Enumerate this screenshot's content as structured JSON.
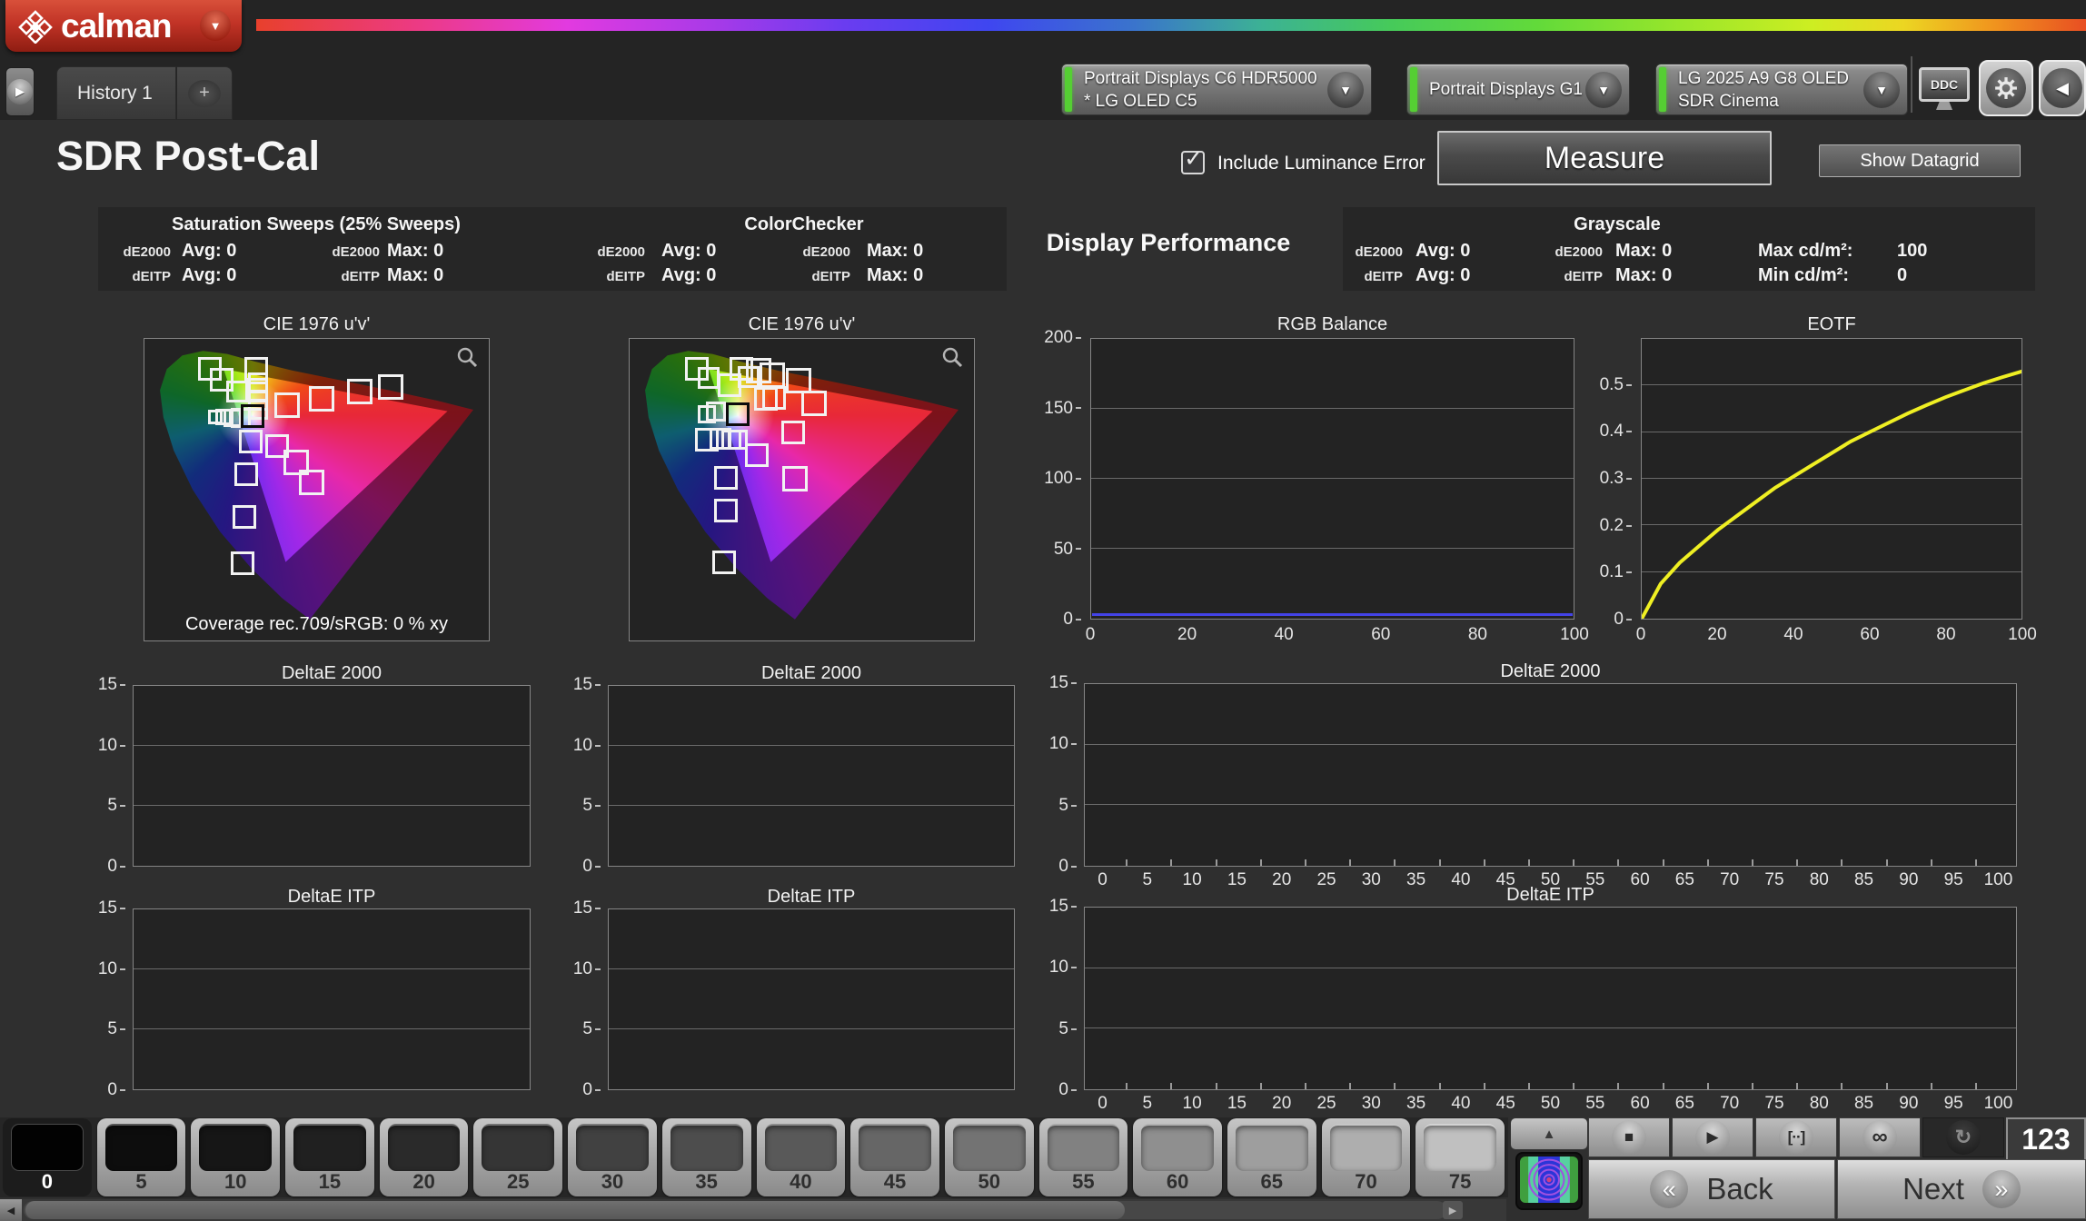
{
  "header": {
    "logo": {
      "text": "calman",
      "dropdown_icon": "▼"
    },
    "tab_strip": {
      "expand_icon": "▶",
      "history_tab": "History 1",
      "add_tab": "+"
    },
    "meters": [
      {
        "line1": "Portrait Displays C6 HDR5000",
        "line2": "* LG OLED C5"
      },
      {
        "line1": "Portrait Displays G1",
        "line2": ""
      },
      {
        "line1": "LG 2025 A9 G8 OLED",
        "line2": "SDR Cinema"
      }
    ],
    "ddc_label": "DDC",
    "collapse_icon": "◀",
    "accent_green": "#55cf33",
    "brand_red": "#c13326"
  },
  "toolbar": {
    "page_title": "SDR Post-Cal",
    "include_luminance_error": "Include Luminance Error",
    "checkbox_checked": true,
    "checkbox_mark": "✓",
    "measure_label": "Measure",
    "show_datagrid_label": "Show Datagrid"
  },
  "stats": {
    "saturation": {
      "title": "Saturation Sweeps (25% Sweeps)",
      "rows": [
        {
          "m1": "dE2000",
          "v1": "Avg: 0",
          "m2": "dE2000",
          "v2": "Max: 0"
        },
        {
          "m1": "dEITP",
          "v1": "Avg: 0",
          "m2": "dEITP",
          "v2": "Max: 0"
        }
      ]
    },
    "colorchecker": {
      "title": "ColorChecker",
      "rows": [
        {
          "m1": "dE2000",
          "v1": "Avg: 0",
          "m2": "dE2000",
          "v2": "Max: 0"
        },
        {
          "m1": "dEITP",
          "v1": "Avg: 0",
          "m2": "dEITP",
          "v2": "Max: 0"
        }
      ]
    },
    "display_performance": "Display Performance",
    "grayscale": {
      "title": "Grayscale",
      "rows": [
        {
          "m1": "dE2000",
          "v1": "Avg: 0",
          "m2": "dE2000",
          "v2": "Max: 0",
          "l3": "Max cd/m²:",
          "v3": "100"
        },
        {
          "m1": "dEITP",
          "v1": "Avg: 0",
          "m2": "dEITP",
          "v2": "Max: 0",
          "l3": "Min cd/m²:",
          "v3": "0"
        }
      ]
    }
  },
  "chart_data": [
    {
      "id": "cie1",
      "type": "scatter",
      "title": "CIE 1976 u'v'",
      "coverage_label": "Coverage rec.709/sRGB:  0 % xy",
      "markers": [
        [
          19,
          10,
          26,
          "w"
        ],
        [
          22.5,
          13.5,
          26,
          "w"
        ],
        [
          27,
          17.5,
          24,
          "w"
        ],
        [
          32.5,
          10,
          26,
          "w"
        ],
        [
          33,
          14.5,
          22,
          "w"
        ],
        [
          33,
          17.5,
          22,
          "w"
        ],
        [
          33,
          20.5,
          22,
          "w"
        ],
        [
          33,
          23.5,
          22,
          "w"
        ],
        [
          41.5,
          22,
          28,
          "w"
        ],
        [
          51.5,
          20,
          28,
          "w"
        ],
        [
          62.5,
          17.5,
          28,
          "w"
        ],
        [
          71.5,
          16,
          28,
          "w"
        ],
        [
          20.5,
          26,
          16,
          "w"
        ],
        [
          23,
          26,
          18,
          "w"
        ],
        [
          25.5,
          26.3,
          20,
          "w"
        ],
        [
          28,
          26.3,
          22,
          "w"
        ],
        [
          31.5,
          25.5,
          26,
          "k"
        ],
        [
          31,
          34,
          26,
          "w"
        ],
        [
          38.5,
          35.5,
          26,
          "w"
        ],
        [
          44,
          41,
          28,
          "w"
        ],
        [
          48.5,
          47.5,
          28,
          "w"
        ],
        [
          29.5,
          45,
          26,
          "w"
        ],
        [
          29,
          59,
          26,
          "w"
        ],
        [
          28.5,
          74.5,
          26,
          "w"
        ]
      ]
    },
    {
      "id": "cie2",
      "type": "scatter",
      "title": "CIE 1976 u'v'",
      "markers": [
        [
          19.5,
          10,
          26,
          "w"
        ],
        [
          23,
          13,
          24,
          "w"
        ],
        [
          29,
          15.5,
          26,
          "w"
        ],
        [
          32.5,
          10,
          26,
          "w"
        ],
        [
          34.5,
          12.5,
          24,
          "w"
        ],
        [
          37.5,
          10.5,
          28,
          "w"
        ],
        [
          41.5,
          12,
          28,
          "w"
        ],
        [
          49,
          14,
          28,
          "w"
        ],
        [
          53.5,
          21.5,
          28,
          "w"
        ],
        [
          39.5,
          20,
          26,
          "w"
        ],
        [
          42,
          19.5,
          26,
          "w"
        ],
        [
          22.5,
          25,
          20,
          "w"
        ],
        [
          25,
          24,
          22,
          "w"
        ],
        [
          31.5,
          25,
          26,
          "k"
        ],
        [
          22.5,
          33.5,
          26,
          "w"
        ],
        [
          26.5,
          33,
          24,
          "w"
        ],
        [
          29.5,
          33.5,
          22,
          "w"
        ],
        [
          31.5,
          33.5,
          22,
          "w"
        ],
        [
          37,
          38.5,
          26,
          "w"
        ],
        [
          47.5,
          31,
          26,
          "w"
        ],
        [
          28,
          46,
          26,
          "w"
        ],
        [
          48,
          46.5,
          28,
          "w"
        ],
        [
          28,
          57,
          26,
          "w"
        ],
        [
          27.5,
          74,
          26,
          "w"
        ]
      ]
    },
    {
      "id": "rgb_balance",
      "type": "line",
      "title": "RGB Balance",
      "ylim": [
        0,
        200
      ],
      "yticks": [
        0,
        50,
        100,
        150,
        200
      ],
      "xticks": [
        0,
        20,
        40,
        60,
        80,
        100
      ],
      "series": [
        {
          "name": "blue",
          "color": "#4343e6",
          "flat_value": 2
        }
      ]
    },
    {
      "id": "eotf",
      "type": "line",
      "title": "EOTF",
      "ylim": [
        0,
        0.6
      ],
      "yticks": [
        0,
        0.1,
        0.2,
        0.3,
        0.4,
        0.5
      ],
      "xticks": [
        0,
        20,
        40,
        60,
        80,
        100
      ],
      "series": [
        {
          "name": "gamma",
          "color": "#efef23",
          "points": [
            [
              0,
              0
            ],
            [
              5,
              0.075
            ],
            [
              10,
              0.12
            ],
            [
              15,
              0.155
            ],
            [
              20,
              0.19
            ],
            [
              25,
              0.22
            ],
            [
              30,
              0.25
            ],
            [
              35,
              0.28
            ],
            [
              40,
              0.305
            ],
            [
              45,
              0.33
            ],
            [
              50,
              0.355
            ],
            [
              55,
              0.38
            ],
            [
              60,
              0.4
            ],
            [
              65,
              0.42
            ],
            [
              70,
              0.44
            ],
            [
              75,
              0.458
            ],
            [
              80,
              0.475
            ],
            [
              85,
              0.49
            ],
            [
              90,
              0.505
            ],
            [
              95,
              0.518
            ],
            [
              100,
              0.53
            ]
          ]
        }
      ]
    },
    {
      "id": "de2000_a",
      "type": "line",
      "title": "DeltaE 2000",
      "ylim": [
        0,
        15
      ],
      "yticks": [
        0,
        5,
        10,
        15
      ],
      "values": []
    },
    {
      "id": "de2000_b",
      "type": "line",
      "title": "DeltaE 2000",
      "ylim": [
        0,
        15
      ],
      "yticks": [
        0,
        5,
        10,
        15
      ],
      "values": []
    },
    {
      "id": "de2000_wide",
      "type": "line",
      "title": "DeltaE 2000",
      "ylim": [
        0,
        15
      ],
      "yticks": [
        0,
        5,
        10,
        15
      ],
      "xticks": [
        0,
        5,
        10,
        15,
        20,
        25,
        30,
        35,
        40,
        45,
        50,
        55,
        60,
        65,
        70,
        75,
        80,
        85,
        90,
        95,
        100
      ],
      "values": []
    },
    {
      "id": "deitp_a",
      "type": "line",
      "title": "DeltaE ITP",
      "ylim": [
        0,
        15
      ],
      "yticks": [
        0,
        5,
        10,
        15
      ],
      "values": []
    },
    {
      "id": "deitp_b",
      "type": "line",
      "title": "DeltaE ITP",
      "ylim": [
        0,
        15
      ],
      "yticks": [
        0,
        5,
        10,
        15
      ],
      "values": []
    },
    {
      "id": "deitp_wide",
      "type": "line",
      "title": "DeltaE ITP",
      "ylim": [
        0,
        15
      ],
      "yticks": [
        0,
        5,
        10,
        15
      ],
      "xticks": [
        0,
        5,
        10,
        15,
        20,
        25,
        30,
        35,
        40,
        45,
        50,
        55,
        60,
        65,
        70,
        75,
        80,
        85,
        90,
        95,
        100
      ],
      "values": []
    }
  ],
  "patches": [
    {
      "label": "0",
      "shade": "#020202",
      "selected": true
    },
    {
      "label": "5",
      "shade": "#0d0d0d"
    },
    {
      "label": "10",
      "shade": "#161616"
    },
    {
      "label": "15",
      "shade": "#202020"
    },
    {
      "label": "20",
      "shade": "#2a2a2a"
    },
    {
      "label": "25",
      "shade": "#353535"
    },
    {
      "label": "30",
      "shade": "#414141"
    },
    {
      "label": "35",
      "shade": "#4d4d4d"
    },
    {
      "label": "40",
      "shade": "#595959"
    },
    {
      "label": "45",
      "shade": "#666666"
    },
    {
      "label": "50",
      "shade": "#737373"
    },
    {
      "label": "55",
      "shade": "#818181"
    },
    {
      "label": "60",
      "shade": "#8f8f8f"
    },
    {
      "label": "65",
      "shade": "#9e9e9e"
    },
    {
      "label": "70",
      "shade": "#aeaeae"
    },
    {
      "label": "75",
      "shade": "#c0c0c0"
    }
  ],
  "transport": {
    "up_icon": "▲",
    "stop_icon": "■",
    "play_icon": "▶",
    "range_icon": "[··]",
    "infinity_icon": "∞",
    "loop_icon": "↻",
    "counter": "123"
  },
  "footer": {
    "back_label": "Back",
    "next_label": "Next",
    "back_icon": "«",
    "next_icon": "»",
    "scroll_left_icon": "◀",
    "scroll_right_icon": "▶"
  }
}
